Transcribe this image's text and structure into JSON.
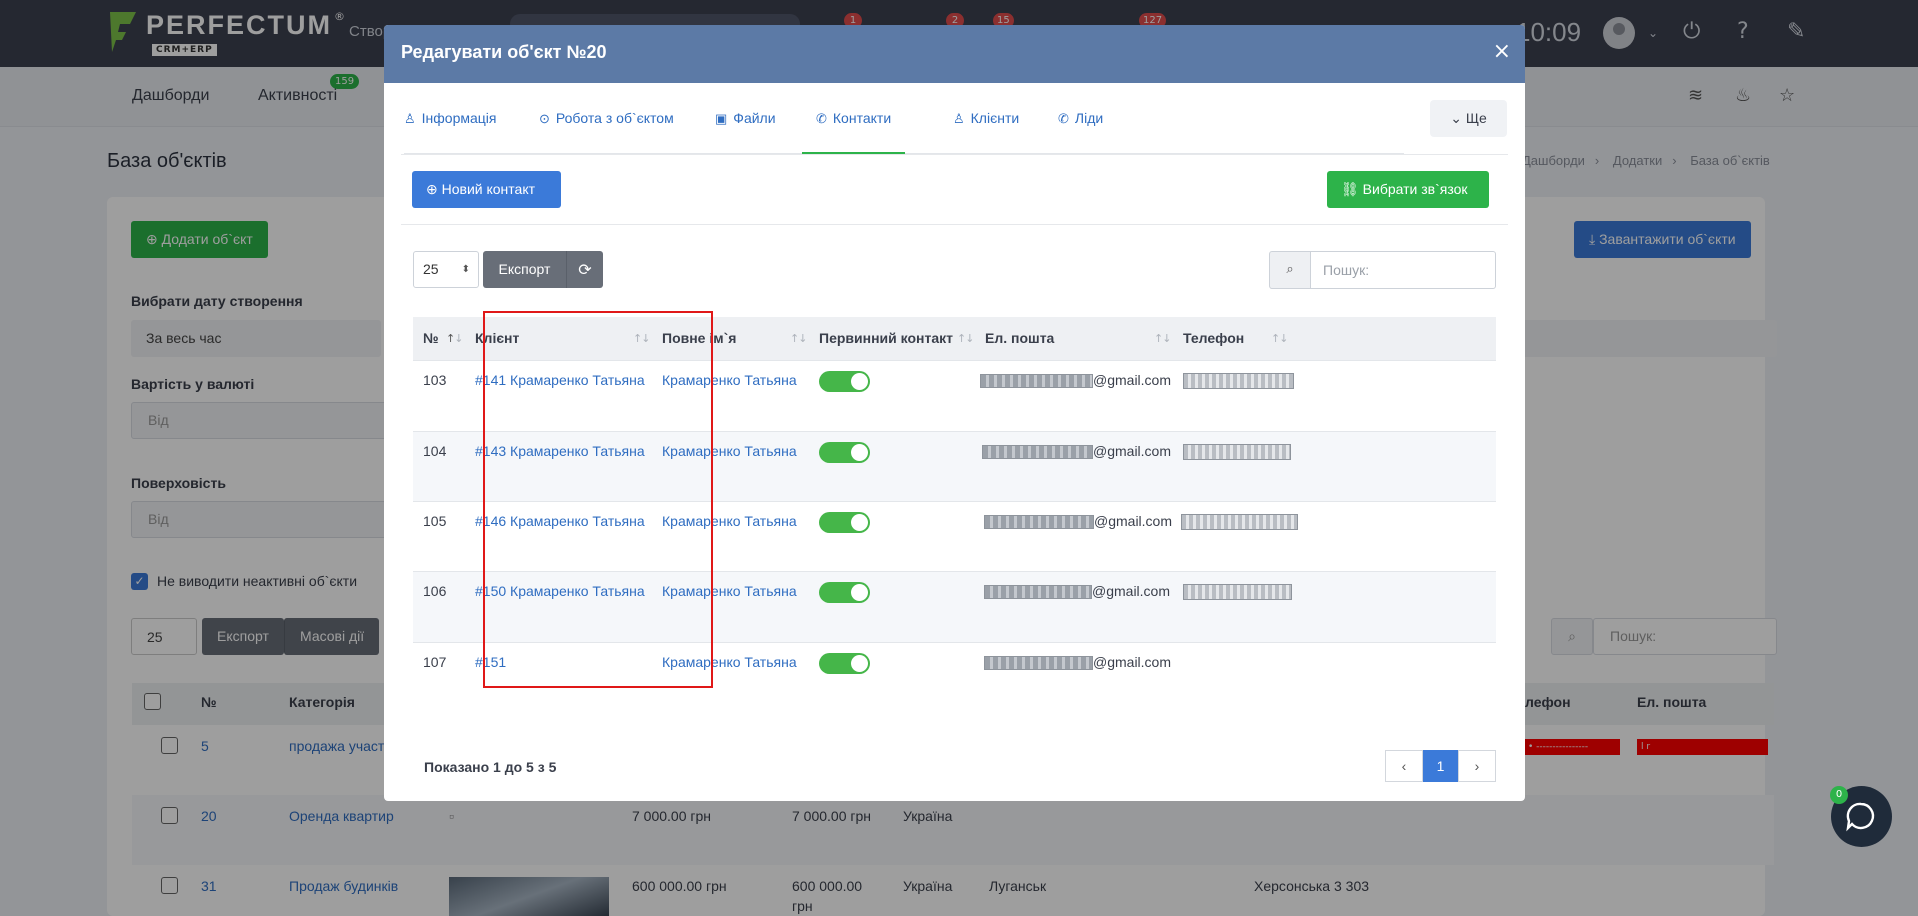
{
  "app": {
    "logo_text": "PERFECTUM",
    "logo_sub": "CRM+ERP",
    "logo_reg": "®",
    "create_label": "Створ",
    "badges": [
      "1",
      "2",
      "15",
      "127"
    ],
    "clock": "10:09"
  },
  "nav": {
    "dashboards": "Дашборди",
    "activity": "Активності",
    "activity_badge": "159"
  },
  "page": {
    "title": "База об'єктів",
    "breadcrumbs": [
      "Дашборди",
      "Додатки",
      "База об`єктів"
    ],
    "add_button": "Додати об`єкт",
    "upload_button": "Завантажити об`єкти",
    "filter_date_label": "Вибрати дату створення",
    "filter_date_value": "За весь час",
    "filter_price_label": "Вартість у валюті",
    "filter_price_placeholder": "Від",
    "filter_floor_label": "Поверховість",
    "filter_floor_placeholder": "Від",
    "inactive_checkbox_label": "Не виводити неактивні об`єкти",
    "page_size": "25",
    "export_label": "Експорт",
    "bulk_label": "Масові дії",
    "search_placeholder": "Пошук:",
    "columns": [
      "№",
      "Категорія",
      "лефон",
      "Ел. пошта"
    ],
    "rows": [
      {
        "num": "5",
        "category": "продажа участ"
      },
      {
        "num": "20",
        "category": "Оренда квартир",
        "price": "7 000.00 грн",
        "price2": "7 000.00 грн",
        "country": "Україна"
      },
      {
        "num": "31",
        "category": "Продаж будинків",
        "price": "600 000.00 грн",
        "price2": "600 000.00",
        "price2_unit": "грн",
        "country": "Україна",
        "city": "Луганськ",
        "address": "Херсонська 3 303"
      }
    ],
    "red_cell_1": "• ----------------",
    "red_cell_2": "l r"
  },
  "chat": {
    "badge": "0"
  },
  "modal": {
    "title": "Редагувати об'єкт №20",
    "close": "×",
    "tabs": [
      {
        "label": "Інформація",
        "icon": "user-icon"
      },
      {
        "label": "Робота з об`єктом",
        "icon": "map-pin-icon"
      },
      {
        "label": "Файли",
        "icon": "image-icon"
      },
      {
        "label": "Контакти",
        "icon": "phone-icon"
      },
      {
        "label": "Клієнти",
        "icon": "users-icon"
      },
      {
        "label": "Ліди",
        "icon": "phone-forward-icon"
      }
    ],
    "more_label": "Ще",
    "new_contact_button": "Новий контакт",
    "choose_link_button": "Вибрати зв`язок",
    "page_size": "25",
    "export_label": "Експорт",
    "search_placeholder": "Пошук:",
    "columns": {
      "num": "№",
      "client": "Клієнт",
      "full_name": "Повне ім`я",
      "primary": "Первинний контакт",
      "email": "Ел. пошта",
      "phone": "Телефон"
    },
    "rows": [
      {
        "num": "103",
        "client": "#141 Крамаренко Татьяна",
        "full_name": "Крамаренко Татьяна",
        "primary": true,
        "email_domain": "@gmail.com",
        "phone_visible": true
      },
      {
        "num": "104",
        "client": "#143 Крамаренко Татьяна",
        "full_name": "Крамаренко Татьяна",
        "primary": true,
        "email_domain": "@gmail.com",
        "phone_visible": true
      },
      {
        "num": "105",
        "client": "#146 Крамаренко Татьяна",
        "full_name": "Крамаренко Татьяна",
        "primary": true,
        "email_domain": "@gmail.com",
        "phone_visible": true
      },
      {
        "num": "106",
        "client": "#150 Крамаренко Татьяна",
        "full_name": "Крамаренко Татьяна",
        "primary": true,
        "email_domain": "@gmail.com",
        "phone_visible": true
      },
      {
        "num": "107",
        "client": "#151",
        "full_name": "Крамаренко Татьяна",
        "primary": true,
        "email_domain": "@gmail.com",
        "phone_visible": false
      }
    ],
    "footer_prefix": "Показано",
    "footer_text": "Показано 1 до 5 з 5",
    "pager": {
      "prev": "‹",
      "current": "1",
      "next": "›"
    }
  },
  "colors": {
    "header_blue": "#5c7aa6",
    "primary": "#3b7ad9",
    "success": "#2db34a",
    "highlight_border": "#e01818",
    "toggle_on": "#45b649"
  }
}
